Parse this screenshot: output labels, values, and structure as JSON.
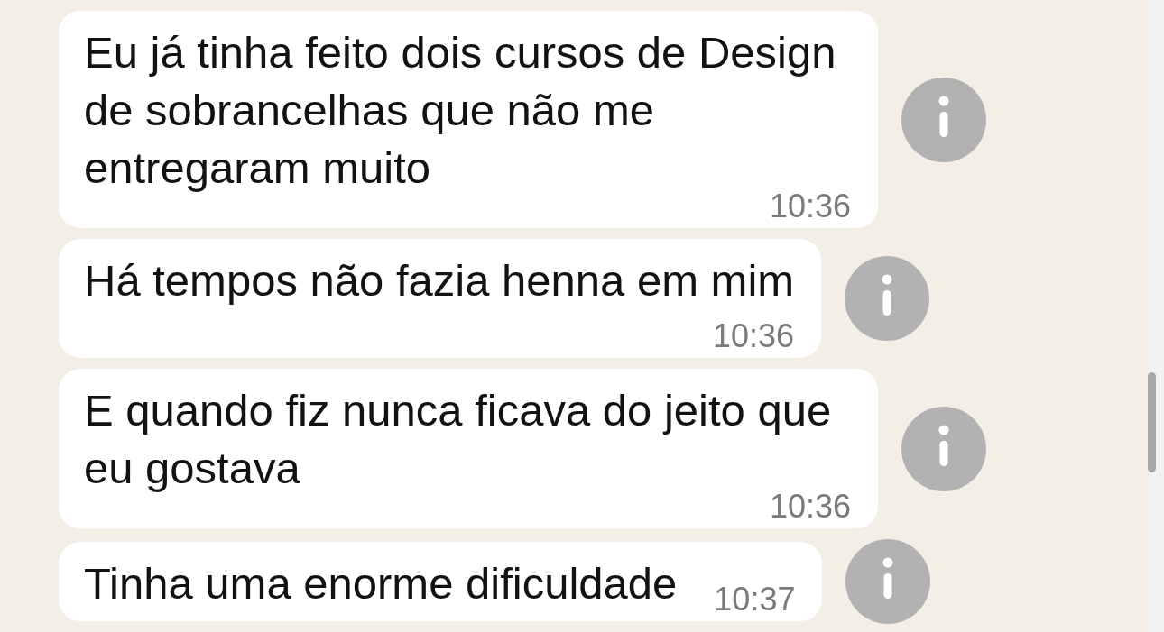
{
  "messages": [
    {
      "text": "Eu já tinha feito dois cursos de Design de sobrancelhas que não me entregaram muito",
      "time": "10:36"
    },
    {
      "text": "Há tempos não fazia henna em mim",
      "time": "10:36"
    },
    {
      "text": "E quando fiz nunca ficava do jeito que eu gostava",
      "time": "10:36"
    },
    {
      "text": "Tinha uma enorme dificuldade",
      "time": "10:37"
    }
  ]
}
